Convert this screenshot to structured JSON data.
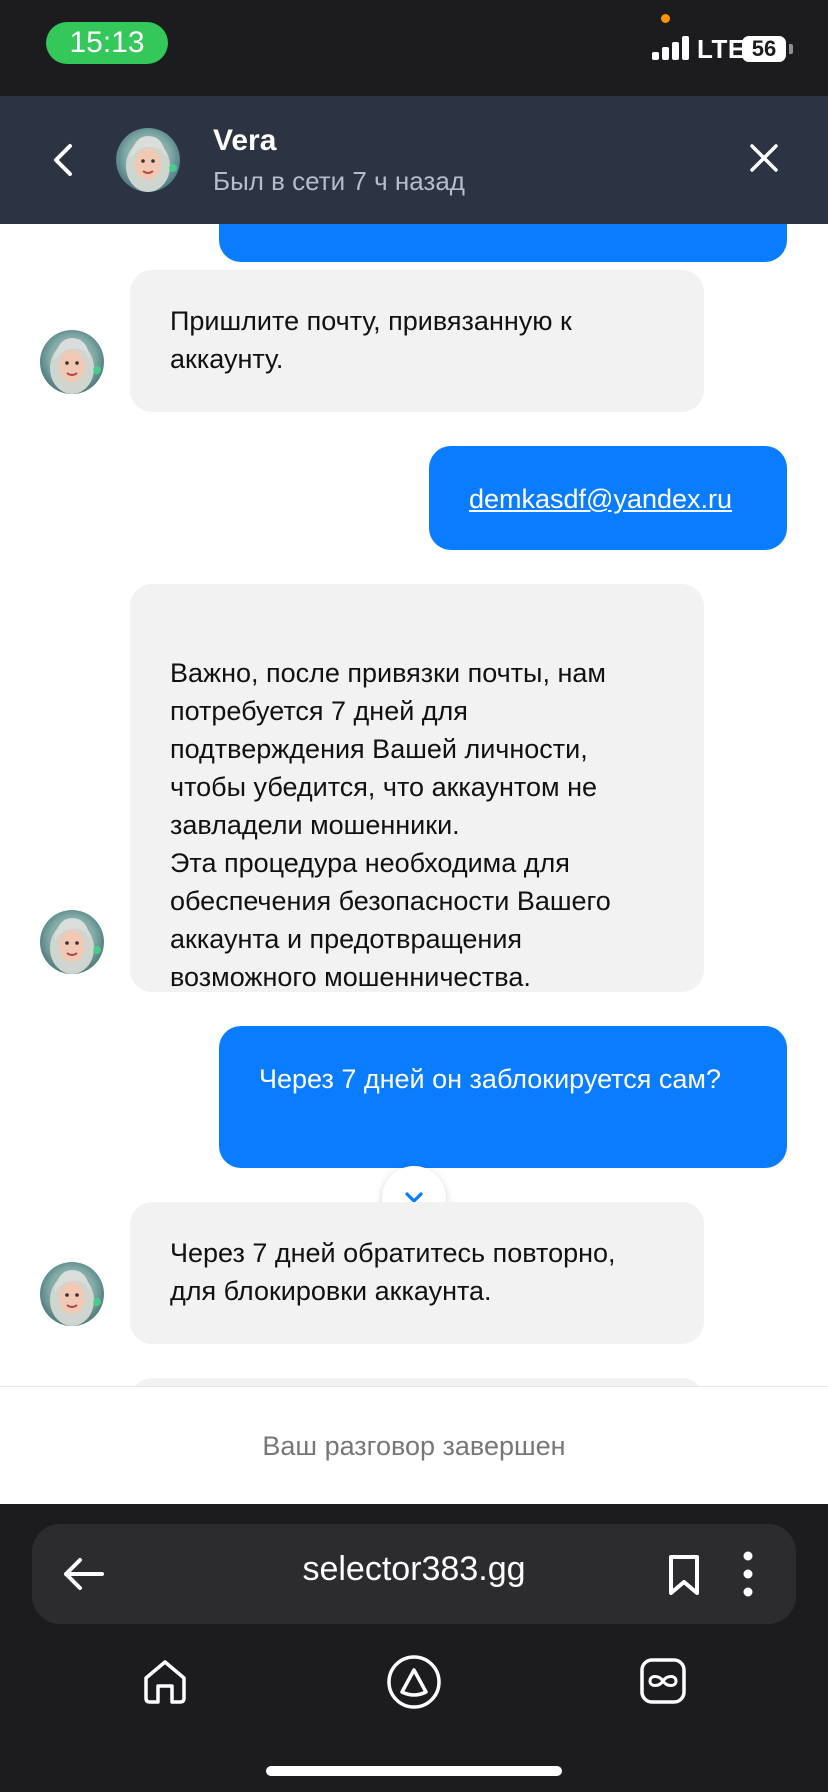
{
  "status_bar": {
    "time": "15:13",
    "network": "LTE",
    "battery": "56"
  },
  "header": {
    "contact_name": "Vera",
    "contact_status": "Был в сети 7 ч назад",
    "back_icon": "chevron-left-icon",
    "close_icon": "close-icon"
  },
  "messages": [
    {
      "from": "agent",
      "text": "Пришлите почту, привязанную к аккаунту."
    },
    {
      "from": "user",
      "text": "demkasdf@yandex.ru"
    },
    {
      "from": "agent",
      "text": "Важно, после привязки почты, нам потребуется 7 дней для подтверждения Вашей личности, чтобы убедится, что аккаунтом не завладели мошенники.\nЭта процедура необходима для обеспечения безопасности Вашего аккаунта и предотвращения возможного мошенничества."
    },
    {
      "from": "user",
      "text": "Через 7 дней он заблокируется сам?"
    },
    {
      "from": "agent",
      "text": "Через 7 дней обратитесь повторно, для блокировки аккаунта."
    }
  ],
  "conversation_ended": "Ваш разговор завершен",
  "browser": {
    "url": "selector383.gg",
    "icons": [
      "arrow-left-icon",
      "bookmark-icon",
      "more-vertical-icon",
      "home-icon",
      "alice-icon",
      "tabs-icon"
    ]
  },
  "colors": {
    "header_bg": "#2c3342",
    "outgoing_bubble": "#0a7cff",
    "incoming_bubble": "#f2f2f2",
    "status_time_pill": "#34c759"
  }
}
